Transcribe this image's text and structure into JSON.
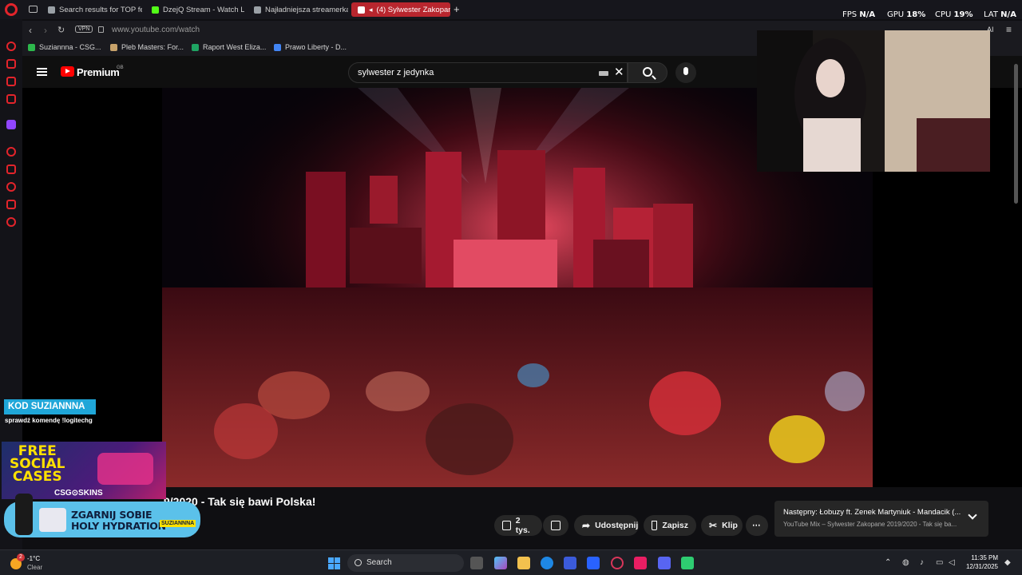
{
  "browser": {
    "tabs": [
      {
        "label": "Search results for TOP fe...",
        "color": "#9aa0a6"
      },
      {
        "label": "DzejQ Stream - Watch Liv...",
        "color": "#53fc18"
      },
      {
        "label": "Najładniejsza streamerka ...",
        "color": "#9aa0a6"
      },
      {
        "label": "(4) Sylwester Zakopan...",
        "color": "#ff0000"
      }
    ],
    "new_tab": "+",
    "stats": {
      "fps_label": "FPS",
      "fps_value": "N/A",
      "gpu_label": "GPU",
      "gpu_value": "18%",
      "cpu_label": "CPU",
      "cpu_value": "19%",
      "lat_label": "LAT",
      "lat_value": "N/A"
    },
    "vpn_badge": "VPN",
    "url": "www.youtube.com/watch",
    "bookmarks": [
      {
        "label": "Suziannna - CSG...",
        "color": "#2db84c"
      },
      {
        "label": "Pleb Masters: For...",
        "color": "#c7a26b"
      },
      {
        "label": "Raport West Eliza...",
        "color": "#1fa463"
      },
      {
        "label": "Prawo Liberty - D...",
        "color": "#4285f4"
      }
    ],
    "extension_ai": "AI"
  },
  "youtube": {
    "logo_text": "Premium",
    "region": "GB",
    "search_value": "sylwester z jedynka",
    "video_title": "9/2020 - Tak się bawi Polska!",
    "actions": {
      "likes": "2 tys.",
      "share": "Udostępnij",
      "save": "Zapisz",
      "clip": "Klip",
      "more": "⋯"
    },
    "next": {
      "title": "Następny: Łobuzy ft. Zenek Martyniuk - Mandacik (...",
      "subtitle": "YouTube Mix – Sylwester Zakopane 2019/2020 - Tak się ba..."
    }
  },
  "overlay": {
    "code": "KOD SUZIANNNA",
    "code_sub": "sprawdź komendę !logitechg",
    "social_1": "FREE",
    "social_2": "SOCIAL",
    "social_3": "CASES",
    "csgo": "CSG⊙SKINS",
    "hydra_1": "ZGARNIJ SOBIE",
    "hydra_2": "HOLY HYDRATION",
    "hydra_tag": "SUZIANNNA"
  },
  "taskbar": {
    "weather_badge": "2",
    "temp": "-1°C",
    "weather_desc": "Clear",
    "search_label": "Search",
    "time": "11:35 PM",
    "date": "12/31/2025"
  }
}
